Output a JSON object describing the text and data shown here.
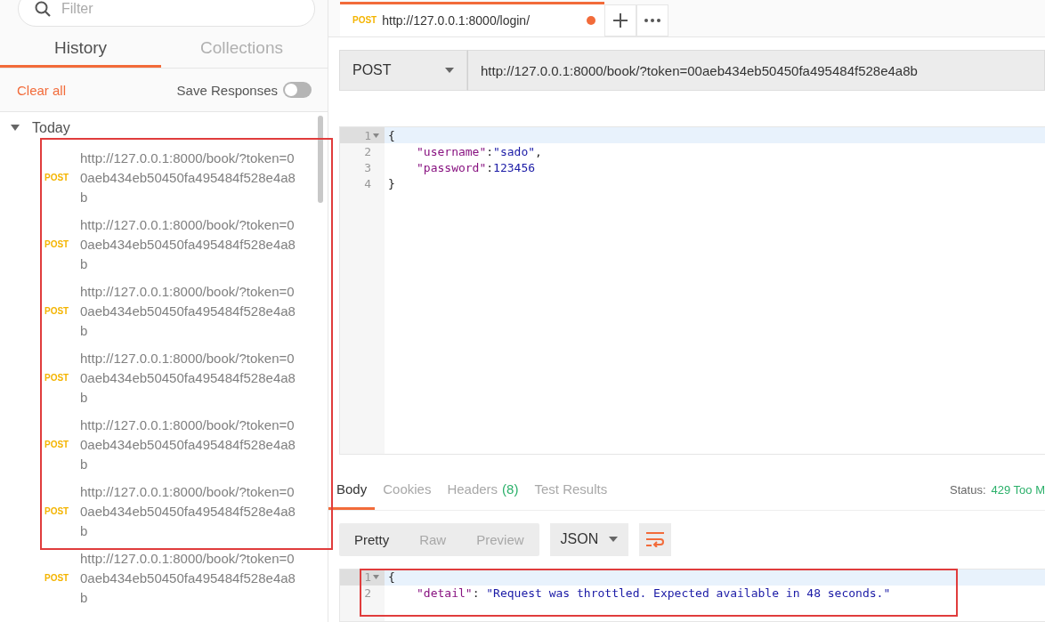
{
  "sidebar": {
    "filter": {
      "placeholder": "Filter"
    },
    "tabs": [
      {
        "label": "History",
        "selected": true
      },
      {
        "label": "Collections",
        "selected": false
      }
    ],
    "clear_all": "Clear all",
    "save_responses": {
      "label": "Save Responses",
      "on": false
    },
    "groups": [
      {
        "label": "Today",
        "expanded": true,
        "items": [
          {
            "method": "POST",
            "url": "http://127.0.0.1:8000/book/?token=00aeb434eb50450fa495484f528e4a8b"
          },
          {
            "method": "POST",
            "url": "http://127.0.0.1:8000/book/?token=00aeb434eb50450fa495484f528e4a8b"
          },
          {
            "method": "POST",
            "url": "http://127.0.0.1:8000/book/?token=00aeb434eb50450fa495484f528e4a8b"
          },
          {
            "method": "POST",
            "url": "http://127.0.0.1:8000/book/?token=00aeb434eb50450fa495484f528e4a8b"
          },
          {
            "method": "POST",
            "url": "http://127.0.0.1:8000/book/?token=00aeb434eb50450fa495484f528e4a8b"
          },
          {
            "method": "POST",
            "url": "http://127.0.0.1:8000/book/?token=00aeb434eb50450fa495484f528e4a8b"
          },
          {
            "method": "POST",
            "url": "http://127.0.0.1:8000/book/?token=00aeb434eb50450fa495484f528e4a8b"
          }
        ]
      }
    ]
  },
  "request_tabs": [
    {
      "method": "POST",
      "url": "http://127.0.0.1:8000/login/",
      "selected": true,
      "unsaved": true
    }
  ],
  "request": {
    "method": "POST",
    "url": "http://127.0.0.1:8000/book/?token=00aeb434eb50450fa495484f528e4a8b"
  },
  "body_editor": {
    "lines": [
      {
        "number": "1",
        "foldable": true,
        "active": true,
        "indented": false,
        "tokens": [
          {
            "kind": "punct",
            "text": "{"
          }
        ]
      },
      {
        "number": "2",
        "foldable": false,
        "active": false,
        "indented": true,
        "tokens": [
          {
            "kind": "key",
            "text": "\"username\""
          },
          {
            "kind": "punct",
            "text": ":"
          },
          {
            "kind": "string",
            "text": "\"sado\""
          },
          {
            "kind": "punct",
            "text": ","
          }
        ]
      },
      {
        "number": "3",
        "foldable": false,
        "active": false,
        "indented": true,
        "tokens": [
          {
            "kind": "key",
            "text": "\"password\""
          },
          {
            "kind": "punct",
            "text": ":"
          },
          {
            "kind": "number",
            "text": "123456"
          }
        ]
      },
      {
        "number": "4",
        "foldable": false,
        "active": false,
        "indented": false,
        "tokens": [
          {
            "kind": "punct",
            "text": "}"
          }
        ]
      }
    ]
  },
  "response": {
    "tabs": [
      {
        "label": "Body",
        "selected": true
      },
      {
        "label": "Cookies",
        "selected": false
      },
      {
        "label": "Headers",
        "count": "(8)",
        "selected": false
      },
      {
        "label": "Test Results",
        "selected": false
      }
    ],
    "status_label": "Status:",
    "status_value": "429 Too M",
    "views": [
      {
        "label": "Pretty",
        "selected": true
      },
      {
        "label": "Raw",
        "selected": false
      },
      {
        "label": "Preview",
        "selected": false
      }
    ],
    "format": "JSON",
    "lines": [
      {
        "number": "1",
        "foldable": true,
        "active": true,
        "indented": false,
        "tokens": [
          {
            "kind": "punct",
            "text": "{"
          }
        ]
      },
      {
        "number": "2",
        "foldable": false,
        "active": false,
        "indented": true,
        "tokens": [
          {
            "kind": "key",
            "text": "\"detail\""
          },
          {
            "kind": "punct",
            "text": ": "
          },
          {
            "kind": "string",
            "text": "\"Request was throttled. Expected available in 48 seconds.\""
          }
        ]
      }
    ]
  }
}
